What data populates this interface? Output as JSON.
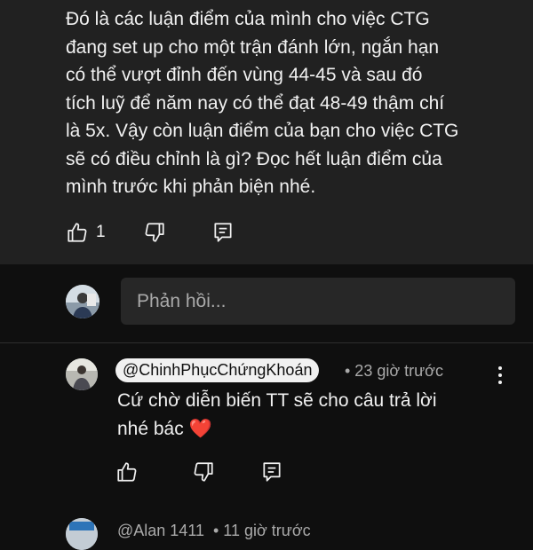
{
  "top_comment": {
    "lines": [
      "Đó là các luận điểm của mình cho việc CTG",
      "đang set up cho một trận đánh lớn, ngắn hạn",
      "có thể vượt đỉnh đến vùng 44-45 và sau đó",
      "tích luỹ để năm nay có thể đạt 48-49 thậm chí",
      "là 5x. Vậy còn luận điểm của bạn cho việc CTG",
      "sẽ có điều chỉnh là gì? Đọc hết luận điểm của",
      "mình trước khi phản biện nhé."
    ],
    "like_icon": "thumbs-up-icon",
    "like_count": "1",
    "dislike_icon": "thumbs-down-icon",
    "reply_icon": "comment-reply-icon"
  },
  "reply_box": {
    "placeholder": "Phản hồi...",
    "avatar_icon": "user-avatar"
  },
  "reply_comment": {
    "handle": "@ChinhPhụcChứngKhoán",
    "timestamp": "• 23 giờ trước",
    "lines": [
      "Cứ chờ diễn biến TT sẽ cho câu trả lời",
      "nhé bác"
    ],
    "emoji": "❤️",
    "like_icon": "thumbs-up-icon",
    "dislike_icon": "thumbs-down-icon",
    "reply_icon": "comment-reply-icon",
    "menu_icon": "more-vertical-icon"
  },
  "next_comment": {
    "handle": "@Alan 1411",
    "timestamp": "• 11 giờ trước"
  },
  "colors": {
    "background": "#0f0f0f",
    "highlight_background": "#212121",
    "text": "#f1f1f1",
    "secondary_text": "#aaaaaa",
    "heart": "#e0243a"
  }
}
